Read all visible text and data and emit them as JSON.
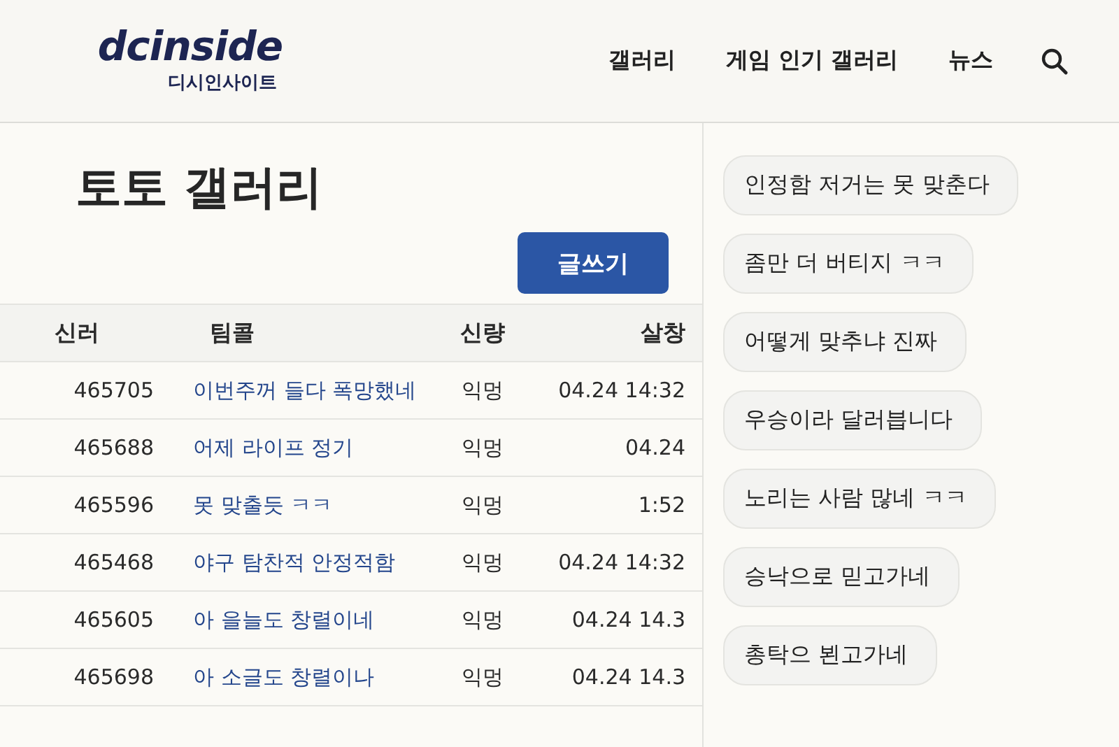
{
  "logo": {
    "wordmark": "dcinside",
    "subtitle": "디시인사이트"
  },
  "nav": [
    {
      "label": "갤러리"
    },
    {
      "label": "게임 인기 갤러리"
    },
    {
      "label": "뉴스"
    }
  ],
  "gallery": {
    "title": "토토 갤러리",
    "write_button": "글쓰기"
  },
  "table": {
    "columns": [
      "신러",
      "팀콜",
      "신량",
      "살창"
    ],
    "rows": [
      {
        "number": "465705",
        "title": "이번주꺼 들다 폭망했네",
        "author": "익멍",
        "date": "04.24 14:32"
      },
      {
        "number": "465688",
        "title": "어제 라이프 정기",
        "author": "익멍",
        "date": "04.24"
      },
      {
        "number": "465596",
        "title": "못 맞출듯 ㅋㅋ",
        "author": "익멍",
        "date": "1:52"
      },
      {
        "number": "465468",
        "title": "야구 탐찬적 안정적함",
        "author": "익멍",
        "date": "04.24 14:32"
      },
      {
        "number": "465605",
        "title": "아 을늘도 창렬이네",
        "author": "익멍",
        "date": "04.24 14.3"
      },
      {
        "number": "465698",
        "title": "아 소글도 창렬이나",
        "author": "익멍",
        "date": "04.24 14.3"
      }
    ]
  },
  "chat": [
    {
      "text": "인정함 저거는 못 맞춘다"
    },
    {
      "text": "좀만 더 버티지 ㅋㅋ"
    },
    {
      "text": "어떻게 맞추냐 진짜"
    },
    {
      "text": "우승이라 달러븝니다"
    },
    {
      "text": "노리는 사람 많네 ㅋㅋ"
    },
    {
      "text": "승낙으로 믿고가네"
    },
    {
      "text": "총탁으 뵌고가네"
    }
  ]
}
